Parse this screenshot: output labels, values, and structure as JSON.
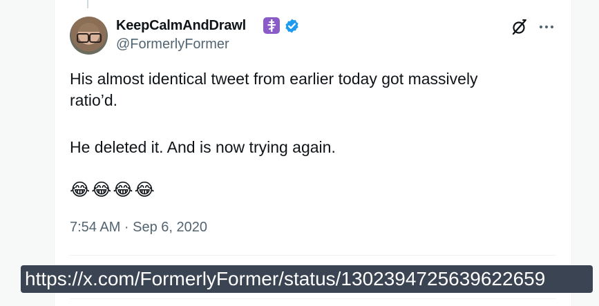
{
  "tweet": {
    "display_name": "KeepCalmAndDrawl",
    "handle": "@FormerlyFormer",
    "line1": "His almost identical tweet from earlier today got massively",
    "line2": "ratio’d.",
    "line3": "He deleted it. And is now trying again.",
    "emojis": "😂😂😂😂",
    "timestamp": "7:54 AM · Sep 6, 2020"
  },
  "icons": {
    "badge": "orthodox-cross-icon",
    "verified": "verified-badge-icon",
    "grok": "grok-icon",
    "more": "more-icon",
    "badge_color": "#8b5cc8",
    "verified_color": "#1d9bf0"
  },
  "overlay": {
    "url": "https://x.com/FormerlyFormer/status/1302394725639622659"
  }
}
